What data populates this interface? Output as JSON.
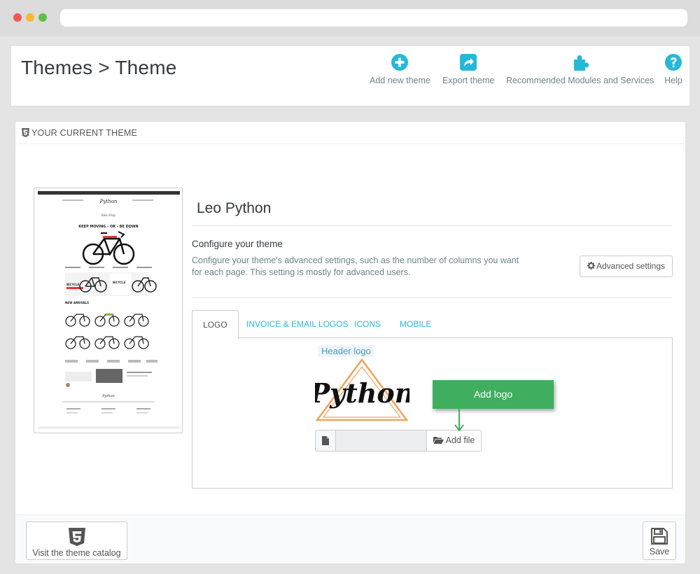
{
  "header": {
    "title": "Themes > Theme",
    "toolbar": [
      {
        "label": "Add new theme",
        "icon": "plus-circle-icon"
      },
      {
        "label": "Export theme",
        "icon": "share-icon"
      },
      {
        "label": "Recommended Modules and Services",
        "icon": "puzzle-icon"
      },
      {
        "label": "Help",
        "icon": "question-circle-icon"
      }
    ]
  },
  "panel": {
    "heading": "Your current theme",
    "theme_name": "Leo Python",
    "configure_title": "Configure your theme",
    "configure_desc": "Configure your theme's advanced settings, such as the number of columns you want for each page. This setting is mostly for advanced users.",
    "advanced_button": "Advanced settings",
    "tabs": [
      "Logo",
      "Invoice & Email Logos",
      "Icons",
      "Mobile"
    ],
    "active_tab": "Logo",
    "logo_label": "Header logo",
    "logo_text": "Python",
    "add_file_label": "Add file",
    "callout": "Add logo"
  },
  "preview": {
    "slogan": "KEEP MOVING - OR - BE DOWN",
    "section": "NEW ARRIVALS"
  },
  "footer": {
    "catalog_button": "Visit the theme catalog",
    "save_button": "Save"
  },
  "colors": {
    "accent": "#25b9d7",
    "callout": "#3fae5e",
    "logo_triangle": "#f0a35a"
  }
}
